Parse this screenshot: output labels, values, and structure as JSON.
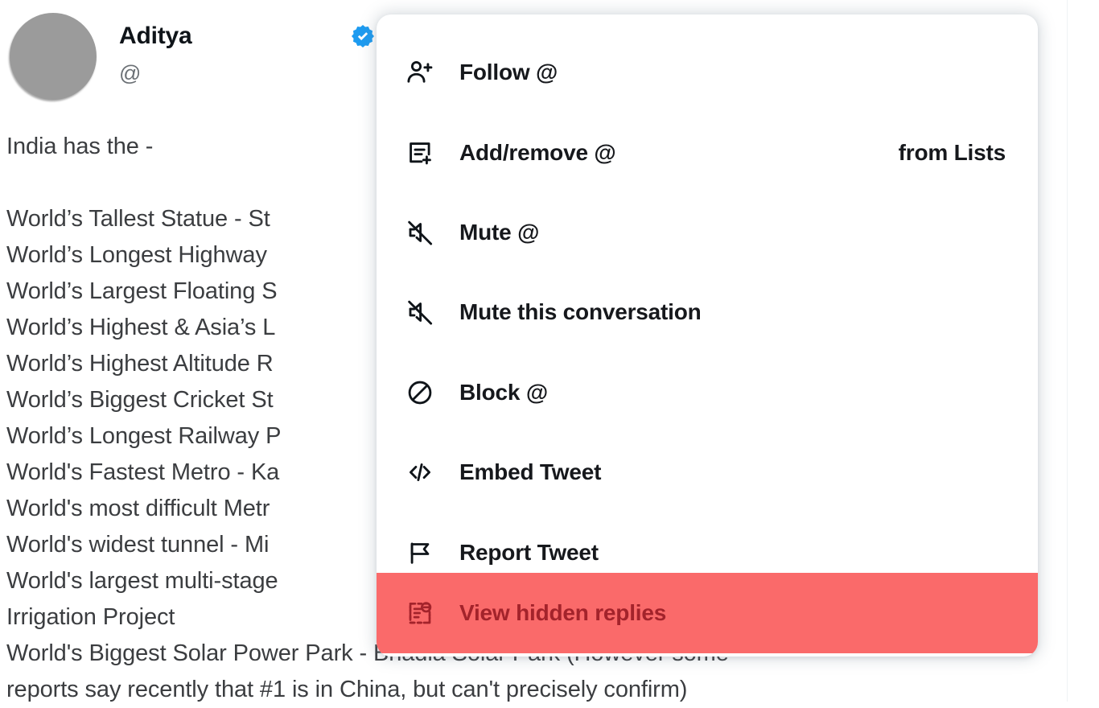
{
  "tweet": {
    "display_name": "Aditya",
    "handle": "@",
    "verified": true,
    "avatar_color": "#9b9b9b",
    "body": "India has the -\n\nWorld’s Tallest Statue - St\nWorld’s Longest Highway \nWorld’s Largest Floating S\nWorld’s Highest & Asia’s L\nWorld’s Highest Altitude R\nWorld’s Biggest Cricket St\nWorld’s Longest Railway P\nWorld's Fastest Metro - Ka\nWorld's most difficult Metr\nWorld's widest tunnel - Mi\nWorld's largest multi-stage\nIrrigation Project\nWorld's Biggest Solar Power Park - Bhadla Solar Park (However some\nreports say recently that #1 is in China, but can't precisely confirm)"
  },
  "menu": {
    "highlight_color": "#fa6a6a",
    "highlight_text_color": "#a3232b",
    "items": [
      {
        "id": "follow",
        "label": "Follow @",
        "suffix": "",
        "icon": "person-plus-icon",
        "highlighted": false
      },
      {
        "id": "add-remove-lists",
        "label": "Add/remove @",
        "suffix": "from Lists",
        "icon": "list-add-icon",
        "highlighted": false
      },
      {
        "id": "mute-user",
        "label": "Mute @",
        "suffix": "",
        "icon": "mute-icon",
        "highlighted": false
      },
      {
        "id": "mute-conversation",
        "label": "Mute this conversation",
        "suffix": "",
        "icon": "mute-icon",
        "highlighted": false
      },
      {
        "id": "block-user",
        "label": "Block @",
        "suffix": "",
        "icon": "block-icon",
        "highlighted": false
      },
      {
        "id": "embed-tweet",
        "label": "Embed Tweet",
        "suffix": "",
        "icon": "code-icon",
        "highlighted": false
      },
      {
        "id": "report-tweet",
        "label": "Report Tweet",
        "suffix": "",
        "icon": "flag-icon",
        "highlighted": false
      },
      {
        "id": "view-hidden-replies",
        "label": "View hidden replies",
        "suffix": "",
        "icon": "hidden-replies-icon",
        "highlighted": true
      }
    ]
  }
}
